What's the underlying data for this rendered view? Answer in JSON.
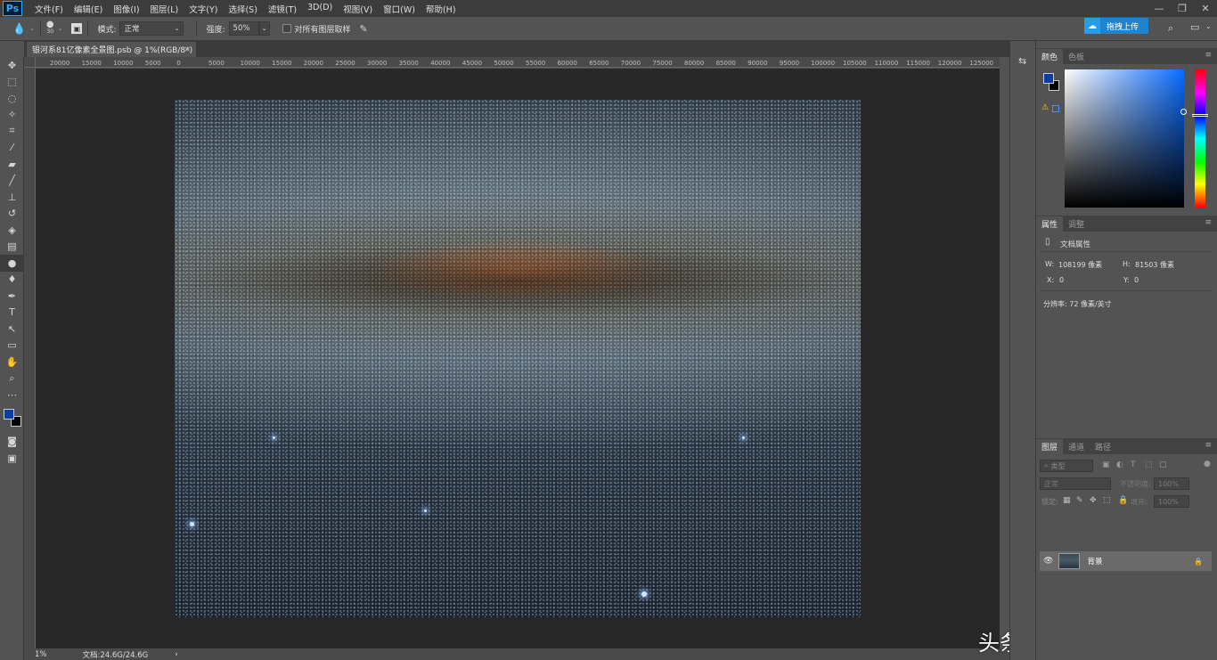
{
  "app": {
    "logo": "Ps"
  },
  "menu": [
    "文件(F)",
    "编辑(E)",
    "图像(I)",
    "图层(L)",
    "文字(Y)",
    "选择(S)",
    "滤镜(T)",
    "3D(D)",
    "视图(V)",
    "窗口(W)",
    "帮助(H)"
  ],
  "window_controls": {
    "minimize": "—",
    "restore": "❐",
    "close": "✕"
  },
  "options_bar": {
    "brush_size": "30",
    "mode_label": "模式:",
    "mode_value": "正常",
    "strength_label": "强度:",
    "strength_value": "50%",
    "sample_all_label": "对所有图层取样"
  },
  "cloud_button": {
    "label": "拖拽上传"
  },
  "document": {
    "tab_title": "银河系81亿像素全景图.psb @ 1%(RGB/8*)",
    "close": "×"
  },
  "ruler_ticks": [
    "20000",
    "15000",
    "10000",
    "5000",
    "0",
    "5000",
    "10000",
    "15000",
    "20000",
    "25000",
    "30000",
    "35000",
    "40000",
    "45000",
    "50000",
    "55000",
    "60000",
    "65000",
    "70000",
    "75000",
    "80000",
    "85000",
    "90000",
    "95000",
    "100000",
    "105000",
    "110000",
    "115000",
    "120000",
    "125000"
  ],
  "status": {
    "zoom": "1%",
    "doc_size": "文档:24.6G/24.6G",
    "arrow": "›"
  },
  "watermark": "头条号 / 系统优木影",
  "panels": {
    "color_tabs": [
      "颜色",
      "色板"
    ],
    "props_tabs": [
      "属性",
      "调整"
    ],
    "props_title": "文档属性",
    "width_label": "W:",
    "width_value": "108199 像素",
    "height_label": "H:",
    "height_value": "81503 像素",
    "x_label": "X:",
    "x_value": "0",
    "y_label": "Y:",
    "y_value": "0",
    "resolution": "分辨率: 72 像素/英寸",
    "layer_tabs": [
      "图层",
      "通道",
      "路径"
    ],
    "layer_filter": "类型",
    "blend_mode": "正常",
    "opacity_label": "不透明度:",
    "opacity_value": "100%",
    "lock_label": "锁定:",
    "fill_label": "填充:",
    "fill_value": "100%",
    "layer_name": "背景"
  },
  "colors": {
    "foreground": "#0b3da8",
    "background": "#000000",
    "accent": "#1e84cf"
  }
}
